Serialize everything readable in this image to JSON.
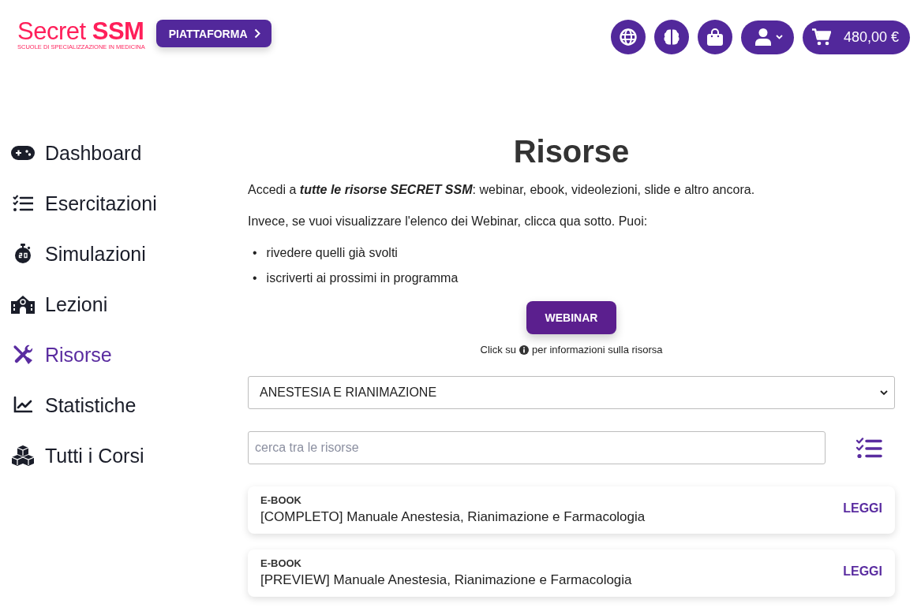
{
  "header": {
    "logo": {
      "wordmark": "Secret **SSM**",
      "tagline": "SCUOLE DI SPECIALIZZAZIONE IN MEDICINA"
    },
    "platform_button": "PIATTAFORMA",
    "cart": {
      "total": "480,00 €"
    }
  },
  "sidebar": {
    "items": [
      {
        "label": "Dashboard",
        "selected": false
      },
      {
        "label": "Esercitazioni",
        "selected": false
      },
      {
        "label": "Simulazioni",
        "selected": false
      },
      {
        "label": "Lezioni",
        "selected": false
      },
      {
        "label": "Risorse",
        "selected": true
      },
      {
        "label": "Statistiche",
        "selected": false
      },
      {
        "label": "Tutti i Corsi",
        "selected": false
      }
    ]
  },
  "main": {
    "title": "Risorse",
    "intro": "Accedi a **tutte le risorse SECRET SSM**: webinar, ebook, videolezioni, slide e altro ancora.",
    "note": "Invece, se vuoi visualizzare l'elenco dei Webinar, clicca qua sotto. Puoi:",
    "bullets": [
      {
        "marker": "•",
        "text": "rivedere quelli già svolti"
      },
      {
        "marker": "•",
        "text": "iscriverti ai prossimi in programma"
      }
    ],
    "webinar_button": "WEBINAR",
    "info_hint": {
      "before": "Click su",
      "after": "per informazioni sulla risorsa"
    },
    "category_select": {
      "value": "ANESTESIA E RIANIMAZIONE"
    },
    "search": {
      "placeholder": "cerca tra le risorse"
    },
    "resources": [
      {
        "type": "E-BOOK",
        "title": "[COMPLETO] Manuale Anestesia, Rianimazione e Farmacologia",
        "action": "LEGGI"
      },
      {
        "type": "E-BOOK",
        "title": "[PREVIEW] Manuale Anestesia, Rianimazione e Farmacologia",
        "action": "LEGGI"
      }
    ]
  }
}
